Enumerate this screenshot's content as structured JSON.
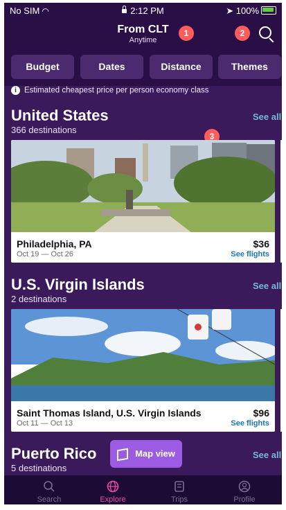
{
  "status_bar": {
    "carrier": "No SIM",
    "time": "2:12 PM",
    "battery": "100%"
  },
  "header": {
    "title": "From CLT",
    "subtitle": "Anytime",
    "search_icon": "search-icon"
  },
  "badges": [
    "1",
    "2",
    "3"
  ],
  "filters": [
    "Budget",
    "Dates",
    "Distance",
    "Themes"
  ],
  "info": {
    "text": "Estimated cheapest price per person economy class",
    "icon": "info-icon"
  },
  "sections": [
    {
      "title": "United States",
      "count": "366 destinations",
      "see_all": "See all",
      "card": {
        "city": "Philadelphia, PA",
        "dates": "Oct 19 — Oct 26",
        "price": "$36",
        "link": "See flights"
      }
    },
    {
      "title": "U.S. Virgin Islands",
      "count": "2 destinations",
      "see_all": "See all",
      "card": {
        "city": "Saint Thomas Island, U.S. Virgin Islands",
        "dates": "Oct 11 — Oct 13",
        "price": "$96",
        "link": "See flights"
      }
    },
    {
      "title": "Puerto Rico",
      "count": "5 destinations",
      "see_all": "See all"
    }
  ],
  "map_button": {
    "label": "Map view",
    "icon": "map-icon"
  },
  "tabs": [
    {
      "label": "Search",
      "icon": "search-icon"
    },
    {
      "label": "Explore",
      "icon": "globe-icon",
      "active": true
    },
    {
      "label": "Trips",
      "icon": "trips-icon"
    },
    {
      "label": "Profile",
      "icon": "profile-icon"
    }
  ],
  "colors": {
    "background": "#3b1a5c",
    "header": "#2a0f47",
    "accent": "#9c5be3",
    "active_tab": "#e94ba0",
    "badge": "#ff5d5d",
    "link": "#76b8d6"
  }
}
